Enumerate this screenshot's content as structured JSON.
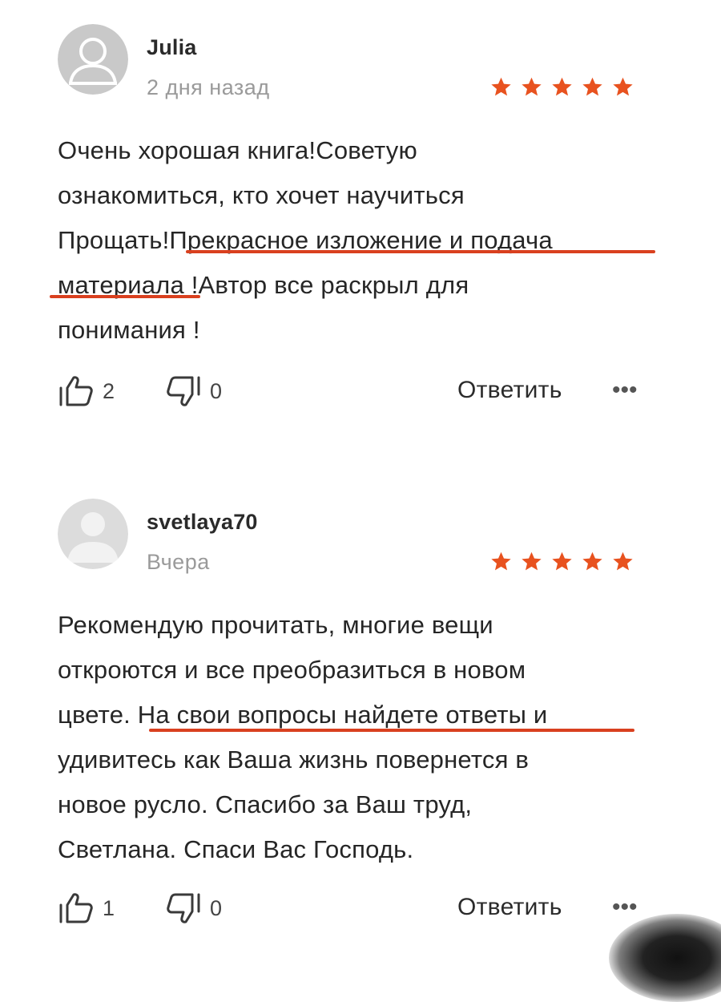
{
  "colors": {
    "accent": "#e8521f",
    "underline": "#d9401f",
    "muted": "#9a9a9a"
  },
  "reviews": [
    {
      "author": "Julia",
      "date": "2 дня назад",
      "rating": 5,
      "avatar_icon": "user-silhouette-icon",
      "text_lines": [
        "Очень хорошая книга!Советую",
        "ознакомиться, кто хочет научиться",
        "Прощать!Прекрасное изложение и подача",
        "материала !Автор все раскрыл для",
        "понимания !"
      ],
      "likes": "2",
      "dislikes": "0",
      "reply_label": "Ответить",
      "more_label": "•••"
    },
    {
      "author": "svetlaya70",
      "date": "Вчера",
      "rating": 5,
      "avatar_icon": "user-placeholder-icon",
      "text_lines": [
        "Рекомендую прочитать, многие вещи",
        "откроются и все преобразиться в новом",
        "цвете. На свои вопросы найдете ответы и",
        "удивитесь как Ваша жизнь повернется в",
        "новое русло. Спасибо за Ваш труд,",
        "Светлана. Спаси Вас Господь."
      ],
      "likes": "1",
      "dislikes": "0",
      "reply_label": "Ответить",
      "more_label": "•••"
    }
  ]
}
